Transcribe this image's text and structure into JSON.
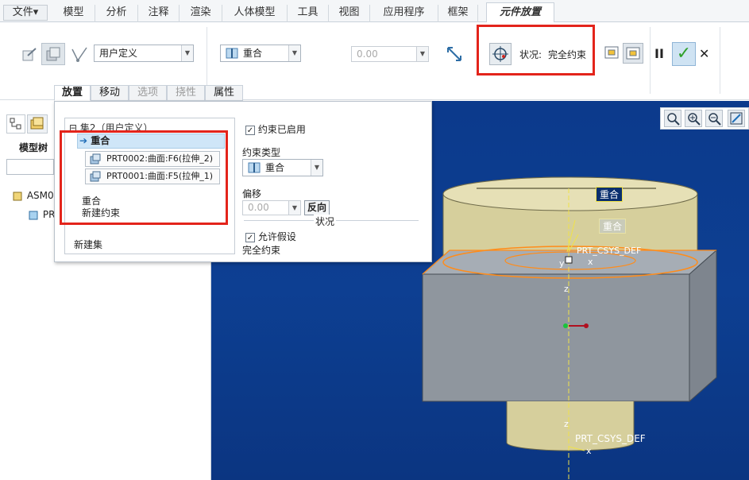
{
  "ribbon_tabs": [
    "文件",
    "模型",
    "分析",
    "注释",
    "渲染",
    "人体模型",
    "工具",
    "视图",
    "应用程序",
    "框架",
    "元件放置"
  ],
  "file_arrow": "▾",
  "toolbar": {
    "constraint_set_type": "用户定义",
    "constraint_type": "重合",
    "offset_value": "0.00",
    "status_label": "状况:",
    "status_value": "完全约束",
    "pause_glyph": "II",
    "confirm_glyph": "✓",
    "cancel_glyph": "✕"
  },
  "sub_tabs": [
    "放置",
    "移动",
    "选项",
    "挠性",
    "属性"
  ],
  "model_tree": {
    "title": "模型树",
    "items": [
      "ASM0",
      "PR"
    ]
  },
  "placement": {
    "set_header": "集2（用户定义）",
    "selected_constraint": "重合",
    "references": [
      "PRT0002:曲面:F6(拉伸_2)",
      "PRT0001:曲面:F5(拉伸_1)"
    ],
    "constraint_item": "重合",
    "new_constraint": "新建约束",
    "new_set": "新建集",
    "enabled_label": "约束已启用",
    "type_label": "约束类型",
    "type_value": "重合",
    "offset_label": "偏移",
    "offset_value": "0.00",
    "flip_button": "反向",
    "status_group": "状况",
    "allow_assumptions": "允许假设",
    "status_text": "完全约束"
  },
  "viewport": {
    "tag_top": "重合",
    "tag_second": "重合",
    "csys_top": "PRT_CSYS_DEF",
    "csys_bottom": "PRT_CSYS_DEF",
    "axis_x": "x",
    "axis_y": "y",
    "axis_z": "z"
  },
  "colors": {
    "accent": "#e3241b",
    "viewport_bg": "#0c3a8c",
    "model_body": "#d9d3a3",
    "block_gray": "#8d949c"
  }
}
